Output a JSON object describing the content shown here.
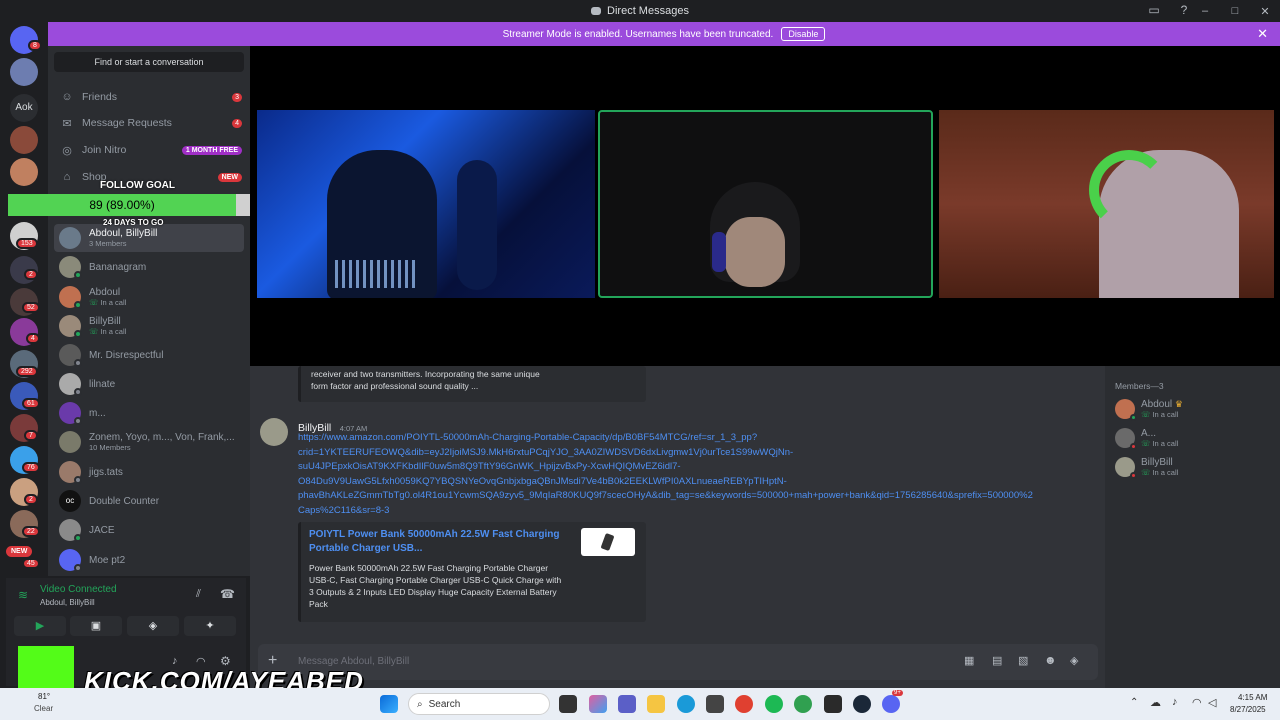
{
  "window": {
    "title": "Direct Messages"
  },
  "banner": {
    "text": "Streamer Mode is enabled. Usernames have been truncated.",
    "button": "Disable"
  },
  "servers": {
    "badges": [
      "8",
      "153",
      "2",
      "52",
      "4",
      "292",
      "61",
      "7",
      "76",
      "2",
      "22",
      "45"
    ],
    "aok_label": "Aok",
    "new_label": "NEW"
  },
  "sidebar": {
    "find_placeholder": "Find or start a conversation",
    "nav": [
      {
        "label": "Friends",
        "count": "3"
      },
      {
        "label": "Message Requests",
        "count": "4"
      },
      {
        "label": "Join Nitro",
        "pill": "1 MONTH FREE"
      },
      {
        "label": "Shop",
        "pill": "NEW"
      }
    ],
    "dms": [
      {
        "name": "Abdoul, BillyBill",
        "sub": "3 Members"
      },
      {
        "name": "Bananagram",
        "sub": ""
      },
      {
        "name": "Abdoul",
        "sub": "In a call"
      },
      {
        "name": "BillyBill",
        "sub": "In a call"
      },
      {
        "name": "Mr. Disrespectful",
        "sub": ""
      },
      {
        "name": "lilnate",
        "sub": ""
      },
      {
        "name": "m...",
        "sub": ""
      },
      {
        "name": "Zonem, Yoyo, m..., Von, Frank,...",
        "sub": "10 Members"
      },
      {
        "name": "jigs.tats",
        "sub": ""
      },
      {
        "name": "Double Counter",
        "sub": ""
      },
      {
        "name": "JACE",
        "sub": ""
      },
      {
        "name": "Moe pt2",
        "sub": ""
      }
    ]
  },
  "follow_goal": {
    "title": "FOLLOW GOAL",
    "value_text": "89 (89.00%)",
    "progress": 0.89,
    "days": "24 DAYS TO GO",
    "goal": "100"
  },
  "voice": {
    "status": "Video Connected",
    "channel": "Abdoul, BillyBill"
  },
  "user": {
    "name": "A"
  },
  "chat": {
    "embed_prev": {
      "lines": [
        "receiver and two transmitters. Incorporating the same unique",
        "form factor and professional sound quality ..."
      ]
    },
    "message": {
      "author": "BillyBill",
      "time": "4:07 AM",
      "link_lines": [
        "https://www.amazon.com/POIYTL-50000mAh-Charging-Portable-Capacity/dp/B0BF54MTCG/ref=sr_1_3_pp?",
        "crid=1YKTEERUFEOWQ&dib=eyJ2IjoiMSJ9.MkH6rxtuPCqjYJO_3AA0ZIWDSVD6dxLivgmw1Vj0urTce1S99wWQjNn-",
        "suU4JPEpxkOisAT9KXFKbdIlF0uw5m8Q9TftY96GnWK_HpijzvBxPy-XcwHQIQMvEZ6idl7-",
        "O84Du9V9UawG5Lfxh0059KQ7YBQSNYeOvqGnbjxbgaQBnJMsdi7Ve4bB0k2EEKLWfPI0AXLnueaeREBYpTIHptN-",
        "phavBhAKLeZGmmTbTg0.ol4R1ou1YcwmSQA9zyv5_9MqIaR80KUQ9f7scecOHyA&dib_tag=se&keywords=500000+mah+power+bank&qid=1756285640&sprefix=500000%2",
        "Caps%2C116&sr=8-3"
      ],
      "embed": {
        "title_lines": [
          "POIYTL Power Bank 50000mAh 22.5W Fast Charging",
          "Portable Charger USB..."
        ],
        "desc_lines": [
          "Power Bank 50000mAh 22.5W Fast Charging Portable Charger",
          "USB-C, Fast Charging Portable Charger USB-C Quick Charge with",
          "3 Outputs & 2 Inputs LED Display Huge Capacity External Battery",
          "Pack"
        ]
      }
    },
    "composer_placeholder": "Message Abdoul, BillyBill"
  },
  "members": {
    "header": "Members—3",
    "list": [
      {
        "name": "Abdoul",
        "sub": "In a call",
        "crown": "♛"
      },
      {
        "name": "A...",
        "sub": "In a call"
      },
      {
        "name": "BillyBill",
        "sub": "In a call"
      }
    ]
  },
  "overlay": {
    "kick_text": "KICK.COM/AYEABED"
  },
  "taskbar": {
    "search": "Search",
    "weather_temp": "81°",
    "weather_label": "Clear",
    "time": "4:15 AM",
    "date": "8/27/2025",
    "discord_badge": "9+"
  },
  "colors": {
    "accent": "#5865f2",
    "banner": "#9b4bdc",
    "online": "#23a55a",
    "link": "#4e8ff2",
    "danger": "#da373c"
  }
}
